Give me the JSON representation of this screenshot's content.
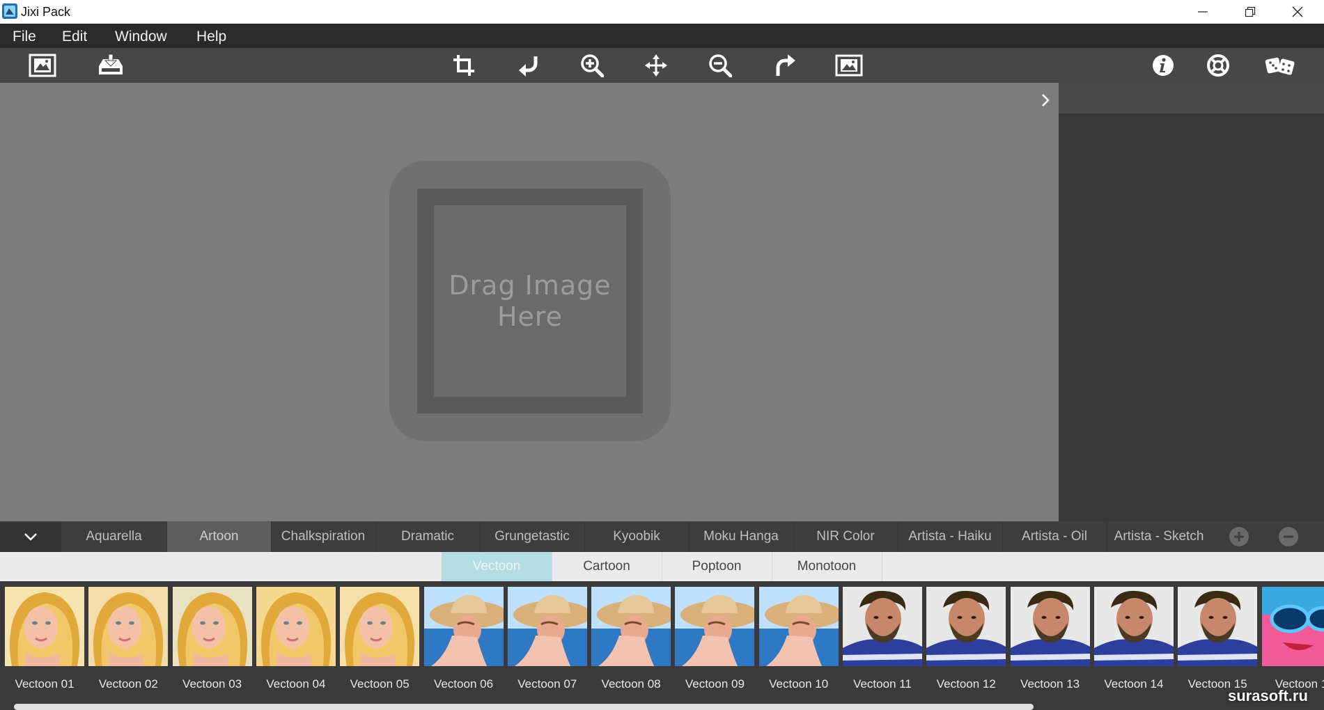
{
  "window": {
    "title": "Jixi Pack",
    "app_icon": "app-logo-icon",
    "controls": [
      "minimize-icon",
      "restore-icon",
      "close-icon"
    ]
  },
  "menu": {
    "file": "File",
    "edit": "Edit",
    "window": "Window",
    "help": "Help"
  },
  "toolbar": {
    "left": [
      "open-image-icon",
      "save-download-icon"
    ],
    "center": [
      "crop-icon",
      "rotate-left-icon",
      "zoom-in-icon",
      "move-icon",
      "zoom-out-icon",
      "rotate-right-icon",
      "fit-image-icon"
    ],
    "right": [
      "info-icon",
      "help-lifebuoy-icon",
      "random-dice-icon"
    ]
  },
  "canvas": {
    "placeholder": "Drag Image Here"
  },
  "categories": {
    "tabs": [
      "Aquarella",
      "Artoon",
      "Chalkspiration",
      "Dramatic",
      "Grungetastic",
      "Kyoobik",
      "Moku Hanga",
      "NIR Color",
      "Artista - Haiku",
      "Artista - Oil",
      "Artista - Sketch"
    ],
    "active": "Artoon"
  },
  "subtabs": {
    "items": [
      "Vectoon",
      "Cartoon",
      "Poptoon",
      "Monotoon"
    ],
    "active": "Vectoon"
  },
  "presets": {
    "items": [
      "Vectoon 01",
      "Vectoon 02",
      "Vectoon 03",
      "Vectoon 04",
      "Vectoon 05",
      "Vectoon 06",
      "Vectoon 07",
      "Vectoon 08",
      "Vectoon 09",
      "Vectoon 10",
      "Vectoon 11",
      "Vectoon 12",
      "Vectoon 13",
      "Vectoon 14",
      "Vectoon 15",
      "Vectoon 1"
    ]
  },
  "watermark": "surasoft.ru",
  "colors": {
    "menubar": "#2b2b2b",
    "toolbar": "#474747",
    "canvas": "#7c7c7c",
    "active_subtab": "#b6dde3"
  }
}
